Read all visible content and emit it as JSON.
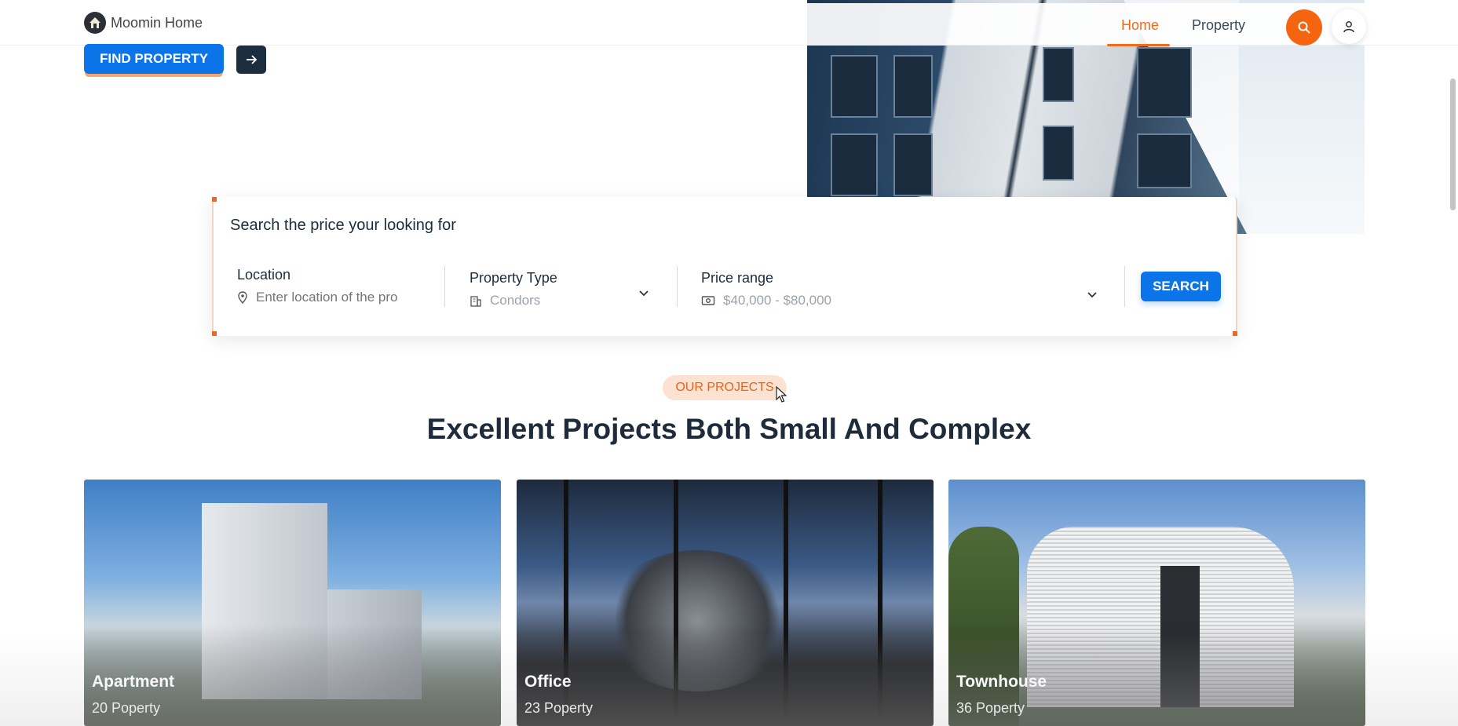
{
  "header": {
    "logo_text": "Moomin Home",
    "nav": [
      {
        "label": "Home",
        "active": true
      },
      {
        "label": "Property",
        "active": false
      }
    ],
    "accent_color": "#f5650f"
  },
  "hero": {
    "find_button_label": "FIND PROPERTY"
  },
  "search": {
    "title": "Search the price your looking for",
    "location": {
      "label": "Location",
      "placeholder": "Enter location of the pro"
    },
    "property_type": {
      "label": "Property Type",
      "value": "Condors"
    },
    "price_range": {
      "label": "Price range",
      "value": "$40,000 - $80,000"
    },
    "submit_label": "SEARCH"
  },
  "projects": {
    "eyebrow": "OUR PROJECTS",
    "heading": "Excellent Projects Both Small And Complex",
    "cards": [
      {
        "title": "Apartment",
        "count": "20 Poperty"
      },
      {
        "title": "Office",
        "count": "23 Poperty"
      },
      {
        "title": "Townhouse",
        "count": "36 Poperty"
      }
    ]
  },
  "colors": {
    "primary": "#0b74e8",
    "accent": "#f5650f",
    "dark": "#1b2d3f"
  }
}
